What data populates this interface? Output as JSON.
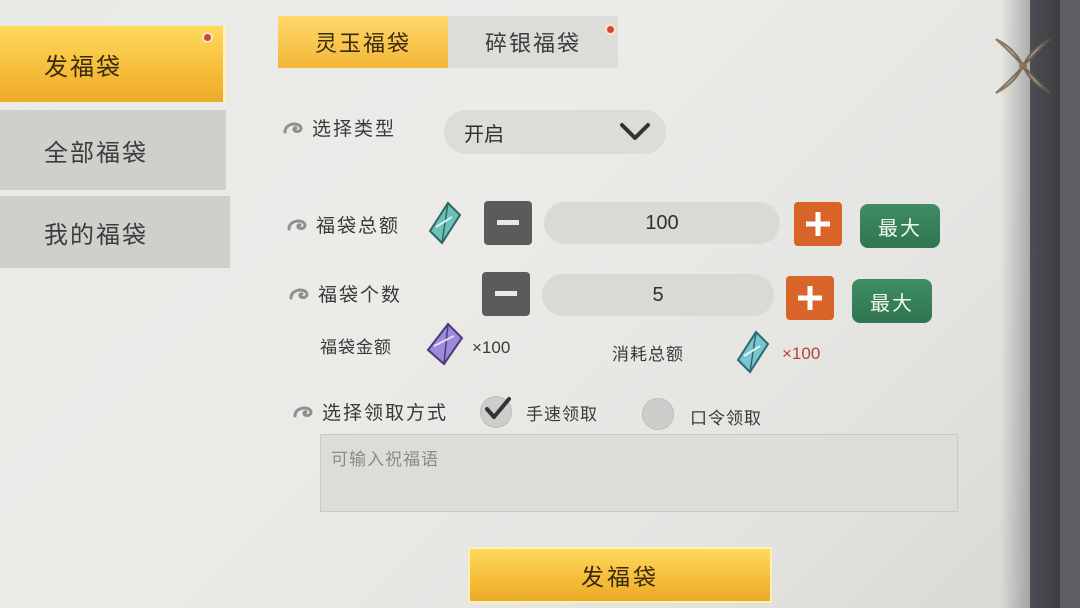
{
  "sidebar": {
    "items": [
      {
        "label": "发福袋",
        "active": true,
        "has_dot": true
      },
      {
        "label": "全部福袋",
        "active": false
      },
      {
        "label": "我的福袋",
        "active": false
      }
    ]
  },
  "tabs": [
    {
      "label": "灵玉福袋",
      "active": true
    },
    {
      "label": "碎银福袋",
      "active": false,
      "has_dot": true
    }
  ],
  "form": {
    "select_type": {
      "label": "选择类型",
      "value": "开启"
    },
    "total_amount": {
      "label": "福袋总额",
      "value": "100",
      "max_label": "最大"
    },
    "count": {
      "label": "福袋个数",
      "value": "5",
      "max_label": "最大"
    },
    "bag_amount": {
      "label": "福袋金额",
      "value": "×100"
    },
    "total_cost": {
      "label": "消耗总额",
      "value": "×100"
    },
    "claim_method": {
      "label": "选择领取方式",
      "options": [
        {
          "label": "手速领取",
          "checked": true
        },
        {
          "label": "口令领取",
          "checked": false
        }
      ]
    },
    "blessing_placeholder": "可输入祝福语"
  },
  "send_button": "发福袋",
  "icons": {
    "close": "ornate-close-icon",
    "gem": "jade-gem-icon",
    "gem_purple": "purple-gem-icon",
    "minus": "minus-icon",
    "plus": "plus-icon",
    "chevron": "chevron-down-icon",
    "swirl": "swirl-bullet-icon",
    "check": "checkmark-icon"
  },
  "colors": {
    "accent_gold": "#f4b834",
    "max_green": "#2f7550",
    "plus_orange": "#d8642a",
    "dot_red": "#d64432"
  }
}
